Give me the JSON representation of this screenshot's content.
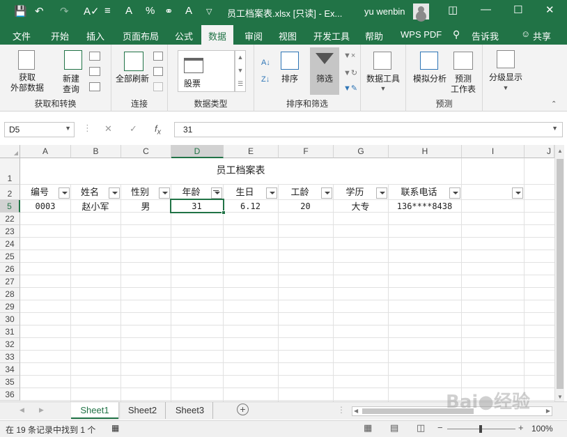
{
  "titlebar": {
    "title": "员工档案表.xlsx [只读] - Ex...",
    "user": "yu wenbin"
  },
  "tabs": [
    "文件",
    "开始",
    "插入",
    "页面布局",
    "公式",
    "数据",
    "审阅",
    "视图",
    "开发工具",
    "帮助",
    "WPS PDF",
    "告诉我",
    "共享"
  ],
  "active_tab": "数据",
  "ribbon": {
    "get_data": "获取\n外部数据",
    "new_query": "新建\n查询",
    "group_get_transform": "获取和转换",
    "refresh_all": "全部刷新",
    "group_connections": "连接",
    "stocks": "股票",
    "group_data_types": "数据类型",
    "sort": "排序",
    "filter": "筛选",
    "group_sort_filter": "排序和筛选",
    "data_tools": "数据工具",
    "what_if": "模拟分析",
    "forecast_sheet": "预测\n工作表",
    "group_forecast": "预测",
    "outline": "分级显示"
  },
  "formula_bar": {
    "name_box": "D5",
    "value": "31"
  },
  "columns": [
    "A",
    "B",
    "C",
    "D",
    "E",
    "F",
    "G",
    "H",
    "I",
    "J"
  ],
  "selected_column": "D",
  "title_row": {
    "row": "1",
    "text": "员工档案表"
  },
  "header_row": {
    "row": "2",
    "cells": [
      "编号",
      "姓名",
      "性别",
      "年龄",
      "生日",
      "工龄",
      "学历",
      "联系电话"
    ]
  },
  "data_row": {
    "row": "5",
    "cells": [
      "0003",
      "赵小军",
      "男",
      "31",
      "6.12",
      "20",
      "大专",
      "136****8438"
    ]
  },
  "empty_rows": [
    "22",
    "23",
    "24",
    "25",
    "26",
    "27",
    "28",
    "29",
    "30",
    "31",
    "32",
    "33",
    "34",
    "35",
    "36"
  ],
  "sheets": [
    "Sheet1",
    "Sheet2",
    "Sheet3"
  ],
  "active_sheet": "Sheet1",
  "statusbar": {
    "text": "在 19 条记录中找到 1 个",
    "zoom": "100%"
  },
  "watermark": "Baidu经验"
}
